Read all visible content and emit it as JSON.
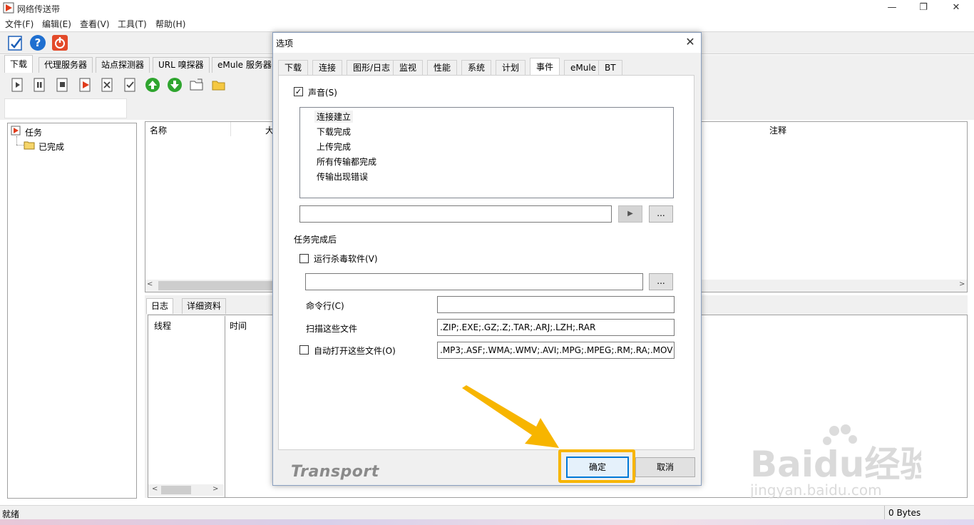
{
  "window": {
    "title": "网络传送带",
    "minimize": "—",
    "maximize": "❐",
    "close": "✕"
  },
  "menu": [
    "文件(F)",
    "编辑(E)",
    "查看(V)",
    "工具(T)",
    "帮助(H)"
  ],
  "main_tabs": [
    "下载",
    "代理服务器",
    "站点探测器",
    "URL 嗅探器",
    "eMule 服务器"
  ],
  "tree": {
    "root": "任务",
    "child": "已完成"
  },
  "list_headers": {
    "name": "名称",
    "size_partial": "大",
    "note": "注释"
  },
  "log_tabs": [
    "日志",
    "详细资料"
  ],
  "log_headers": {
    "thread": "线程",
    "time": "时间"
  },
  "status": {
    "left": "就绪",
    "right": "0 Bytes"
  },
  "dialog": {
    "title": "选项",
    "close": "✕",
    "tabs": [
      "下载",
      "连接",
      "图形/日志",
      "监视",
      "性能",
      "系统",
      "计划",
      "事件",
      "eMule",
      "BT"
    ],
    "active_tab": "事件",
    "sound_label": "声音(S)",
    "sound_checked": "✓",
    "events": [
      "连接建立",
      "下载完成",
      "上传完成",
      "所有传输都完成",
      "传输出现错误"
    ],
    "sound_path": "",
    "play_button": "▶",
    "browse_button": "...",
    "after_complete_label": "任务完成后",
    "antivirus_label": "运行杀毒软件(V)",
    "antivirus_path": "",
    "browse_button2": "...",
    "cmdline_label": "命令行(C)",
    "cmdline_value": "",
    "scan_label": "扫描这些文件",
    "scan_value": ".ZIP;.EXE;.GZ;.Z;.TAR;.ARJ;.LZH;.RAR",
    "auto_open_label": "自动打开这些文件(O)",
    "auto_open_value": ".MP3;.ASF;.WMA;.WMV;.AVI;.MPG;.MPEG;.RM;.RA;.MOV",
    "brand": "Transport",
    "ok_button": "确定",
    "cancel_button": "取消"
  },
  "colors": {
    "highlight": "#f7b500",
    "arrow": "#f7b500",
    "ok_border": "#0078d7"
  },
  "watermark": {
    "logo": "Baidu经验",
    "url": "jingyan.baidu.com"
  }
}
